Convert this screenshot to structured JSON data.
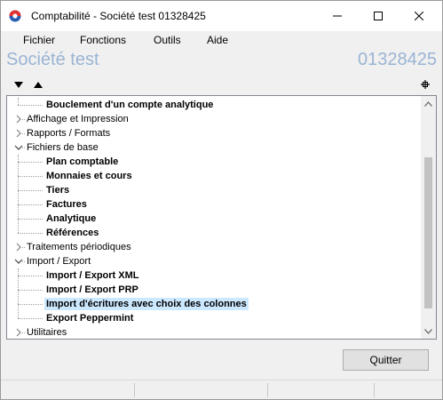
{
  "window": {
    "title": "Comptabilité - Société test 01328425"
  },
  "menu": [
    "Fichier",
    "Fonctions",
    "Outils",
    "Aide"
  ],
  "header": {
    "company_name": "Société test",
    "company_code": "01328425"
  },
  "tree": {
    "items": [
      {
        "label": "Bouclement d'un compte analytique",
        "level": 1,
        "bold": true
      },
      {
        "label": "Affichage et Impression",
        "level": 0,
        "state": "collapsed"
      },
      {
        "label": "Rapports / Formats",
        "level": 0,
        "state": "collapsed"
      },
      {
        "label": "Fichiers de base",
        "level": 0,
        "state": "expanded"
      },
      {
        "label": "Plan comptable",
        "level": 1,
        "bold": true
      },
      {
        "label": "Monnaies et cours",
        "level": 1,
        "bold": true
      },
      {
        "label": "Tiers",
        "level": 1,
        "bold": true
      },
      {
        "label": "Factures",
        "level": 1,
        "bold": true
      },
      {
        "label": "Analytique",
        "level": 1,
        "bold": true
      },
      {
        "label": "Références",
        "level": 1,
        "bold": true
      },
      {
        "label": "Traitements périodiques",
        "level": 0,
        "state": "collapsed"
      },
      {
        "label": "Import / Export",
        "level": 0,
        "state": "expanded"
      },
      {
        "label": "Import / Export XML",
        "level": 1,
        "bold": true
      },
      {
        "label": "Import / Export PRP",
        "level": 1,
        "bold": true
      },
      {
        "label": "Import d'écritures avec choix des colonnes",
        "level": 1,
        "bold": true,
        "selected": true
      },
      {
        "label": "Export Peppermint",
        "level": 1,
        "bold": true
      },
      {
        "label": "Utilitaires",
        "level": 0,
        "state": "collapsed"
      }
    ],
    "scroll_position": 0.75
  },
  "buttons": {
    "quit_label": "Quitter"
  },
  "colors": {
    "header_text": "#9ab4d4",
    "selection": "#cce8ff"
  }
}
